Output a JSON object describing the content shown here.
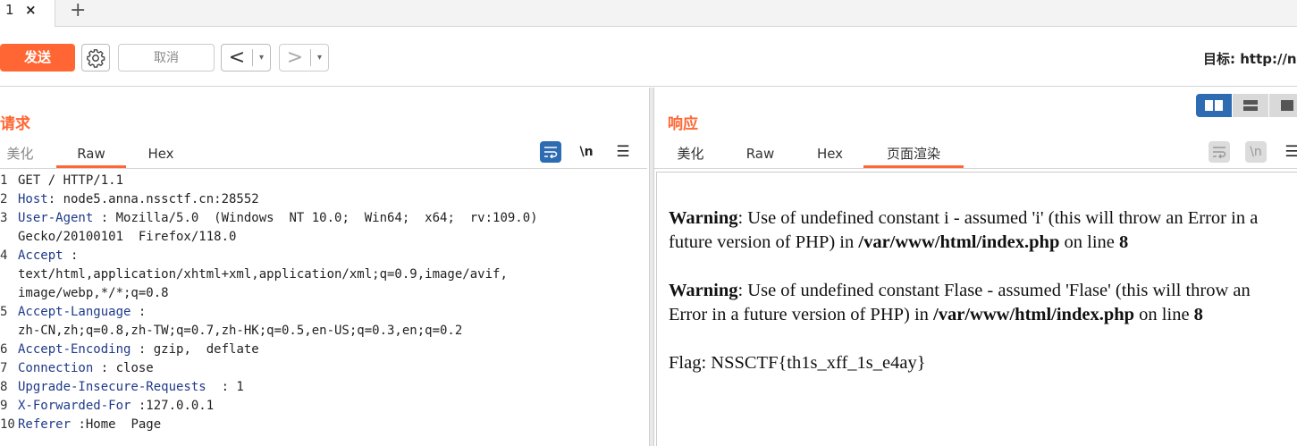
{
  "tabstrip": {
    "tab_number": "1",
    "close_glyph": "×",
    "new_tab_glyph": "+"
  },
  "toolbar": {
    "send_label": "发送",
    "settings_icon": "gear-icon",
    "cancel_label": "取消",
    "back_glyph": "<",
    "forward_glyph": ">",
    "dropdown_glyph": "▾",
    "target_label": "目标: http://n"
  },
  "request": {
    "title": "请求",
    "tabs": [
      "美化",
      "Raw",
      "Hex"
    ],
    "active_tab": "Raw",
    "newline_toggle": "\\n",
    "menu_glyph": "☰",
    "lines": [
      {
        "n": "1",
        "key": "",
        "rest": "GET / HTTP/1.1"
      },
      {
        "n": "2",
        "key": "Host",
        "rest": ": node5.anna.nssctf.cn:28552"
      },
      {
        "n": "3",
        "key": "User-Agent",
        "rest": " : Mozilla/5.0  (Windows  NT 10.0;  Win64;  x64;  rv:109.0)"
      },
      {
        "n": "",
        "key": "",
        "rest": "Gecko/20100101  Firefox/118.0"
      },
      {
        "n": "4",
        "key": "Accept",
        "rest": " :"
      },
      {
        "n": "",
        "key": "",
        "rest": "text/html,application/xhtml+xml,application/xml;q=0.9,image/avif,"
      },
      {
        "n": "",
        "key": "",
        "rest": "image/webp,*/*;q=0.8"
      },
      {
        "n": "5",
        "key": "Accept-Language",
        "rest": " :"
      },
      {
        "n": "",
        "key": "",
        "rest": "zh-CN,zh;q=0.8,zh-TW;q=0.7,zh-HK;q=0.5,en-US;q=0.3,en;q=0.2"
      },
      {
        "n": "6",
        "key": "Accept-Encoding",
        "rest": " : gzip,  deflate"
      },
      {
        "n": "7",
        "key": "Connection",
        "rest": " : close"
      },
      {
        "n": "8",
        "key": "Upgrade-Insecure-Requests",
        "rest": "  : 1"
      },
      {
        "n": "9",
        "key": "X-Forwarded-For",
        "rest": " :127.0.0.1"
      },
      {
        "n": "10",
        "key": "Referer",
        "rest": " :Home  Page"
      }
    ]
  },
  "response": {
    "title": "响应",
    "tabs": [
      "美化",
      "Raw",
      "Hex",
      "页面渲染"
    ],
    "active_tab": "页面渲染",
    "newline_toggle": "\\n",
    "menu_glyph": "☰",
    "render": {
      "w1_label": "Warning",
      "w1_text": ": Use of undefined constant i - assumed 'i' (this will throw an Error in a future version of PHP) in ",
      "w1_path": "/var/www/html/index.php",
      "w1_online": " on line ",
      "w1_line": "8",
      "w2_label": "Warning",
      "w2_text": ": Use of undefined constant Flase - assumed 'Flase' (this will throw an Error in a future version of PHP) in ",
      "w2_path": "/var/www/html/index.php",
      "w2_online": " on line ",
      "w2_line": "8",
      "flag": "Flag: NSSCTF{th1s_xff_1s_e4ay}"
    }
  },
  "colors": {
    "accent": "#ff6633",
    "primary_blue": "#2d6bb3",
    "header_key": "#1f3a8a"
  }
}
